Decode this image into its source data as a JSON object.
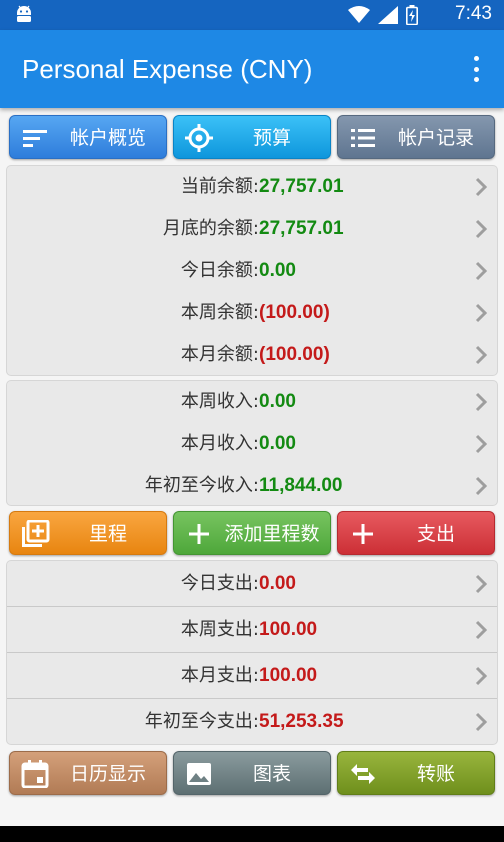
{
  "status_bar": {
    "time": "7:43",
    "icons": [
      "android-icon",
      "wifi-icon",
      "signal-icon",
      "battery-icon"
    ]
  },
  "app_bar": {
    "title": "Personal Expense (CNY)",
    "menu_icon": "more-vert-icon"
  },
  "top_buttons": [
    {
      "label": "帐户概览",
      "icon": "sort-lines-icon",
      "color": "#3b8fe8"
    },
    {
      "label": "预算",
      "icon": "target-icon",
      "color": "#1aa5e8"
    },
    {
      "label": "帐户记录",
      "icon": "list-icon",
      "color": "#6d829b"
    }
  ],
  "balance_panel": [
    {
      "label": "当前余额:",
      "value": "27,757.01",
      "sign": "positive"
    },
    {
      "label": "月底的余额:",
      "value": "27,757.01",
      "sign": "positive"
    },
    {
      "label": "今日余额:",
      "value": "0.00",
      "sign": "positive"
    },
    {
      "label": "本周余额:",
      "value": "(100.00)",
      "sign": "negative"
    },
    {
      "label": "本月余额:",
      "value": "(100.00)",
      "sign": "negative"
    }
  ],
  "income_panel": [
    {
      "label": "本周收入:",
      "value": "0.00",
      "sign": "positive"
    },
    {
      "label": "本月收入:",
      "value": "0.00",
      "sign": "positive"
    },
    {
      "label": "年初至今收入:",
      "value": "11,844.00",
      "sign": "positive"
    }
  ],
  "middle_buttons": [
    {
      "label": "里程",
      "icon": "add-library-icon",
      "color": "#f29525"
    },
    {
      "label": "添加里程数",
      "icon": "plus-icon",
      "color": "#5fb44a"
    },
    {
      "label": "支出",
      "icon": "plus-icon",
      "color": "#d9414a"
    }
  ],
  "expense_panel": [
    {
      "label": "今日支出:",
      "value": "0.00",
      "sign": "negative"
    },
    {
      "label": "本周支出:",
      "value": "100.00",
      "sign": "negative"
    },
    {
      "label": "本月支出:",
      "value": "100.00",
      "sign": "negative"
    },
    {
      "label": "年初至今支出:",
      "value": "51,253.35",
      "sign": "negative"
    }
  ],
  "bottom_buttons": [
    {
      "label": "日历显示",
      "icon": "calendar-icon",
      "color": "#c48e66"
    },
    {
      "label": "图表",
      "icon": "image-icon",
      "color": "#748588"
    },
    {
      "label": "转账",
      "icon": "swap-arrows-icon",
      "color": "#82a22a"
    }
  ],
  "colors": {
    "status_bar": "#1565c0",
    "app_bar": "#1e88e5",
    "positive_value": "#138a12",
    "negative_value": "#c41a1a"
  }
}
